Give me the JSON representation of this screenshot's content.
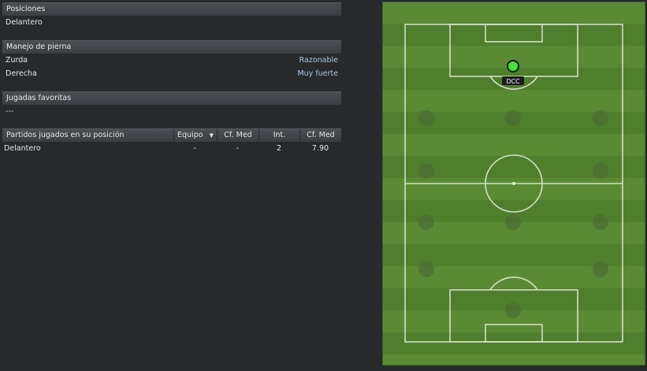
{
  "sections": {
    "positions": {
      "title": "Posiciones",
      "value": "Delantero"
    },
    "footedness": {
      "title": "Manejo de pierna",
      "rows": [
        {
          "label": "Zurda",
          "value": "Razonable"
        },
        {
          "label": "Derecha",
          "value": "Muy fuerte"
        }
      ]
    },
    "favorite_moves": {
      "title": "Jugadas favoritas",
      "value": "---"
    },
    "matches": {
      "headers": [
        "Partidos jugados en su posición",
        "Equipo",
        "Cf. Med",
        "Int.",
        "Cf. Med"
      ],
      "sort_icon": "▼",
      "rows": [
        [
          "Delantero",
          "-",
          "-",
          "2",
          "7.90"
        ]
      ]
    }
  },
  "pitch": {
    "player_label": "DCC",
    "player_color": "#44e23a",
    "field_color": "#5b8a35"
  }
}
